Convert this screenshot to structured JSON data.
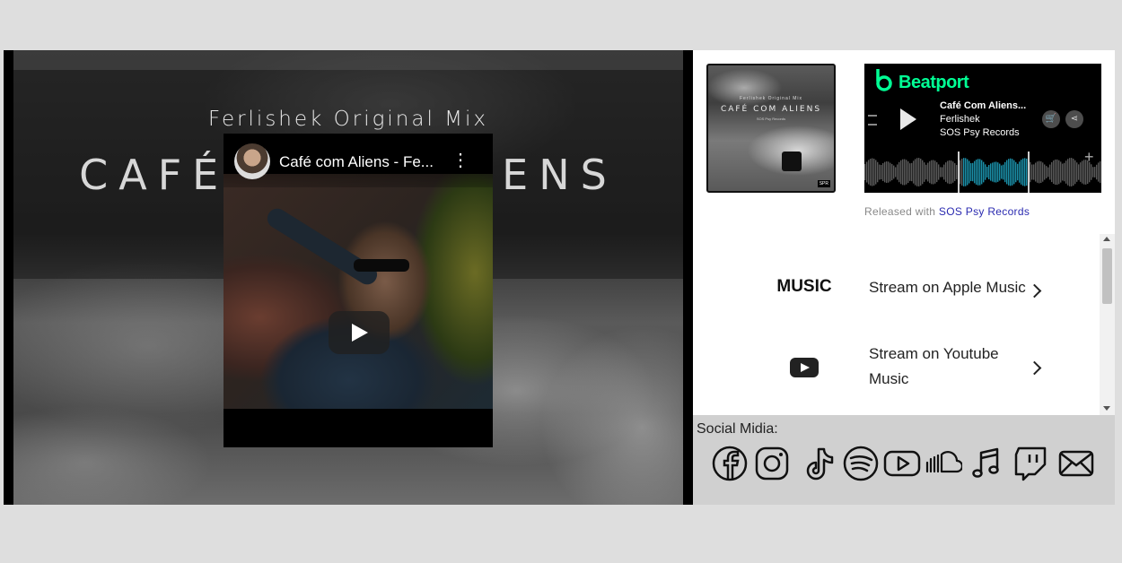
{
  "hero": {
    "subtitle": "Ferlishek Original Mix",
    "title": "CAFÉ COM ALIENS"
  },
  "youtube": {
    "title": "Café com Aliens - Fe...",
    "menu": "⋮"
  },
  "cover": {
    "subtitle": "Ferlishek Original Mix",
    "title": "CAFÉ COM ALIENS",
    "label": "SOS Psy Records",
    "badge": "SPR"
  },
  "beatport": {
    "brand": "Beatport",
    "track": "Café Com Aliens...",
    "artist": "Ferlishek",
    "label": "SOS Psy Records",
    "plus": "+",
    "brand_color": "#01ff95"
  },
  "released": {
    "prefix": "Released with",
    "label": "SOS Psy Records"
  },
  "streaming": [
    {
      "logo_text": "MUSIC",
      "logo_icon": "apple-icon",
      "line1": "Stream on Apple Music",
      "line2": ""
    },
    {
      "logo_icon": "youtube-icon",
      "line1": "Stream on Youtube",
      "line2": "Music"
    }
  ],
  "social": {
    "title": "Social Midia:",
    "icons": [
      "facebook-icon",
      "instagram-icon",
      "tiktok-icon",
      "spotify-icon",
      "youtube-icon",
      "soundcloud-icon",
      "music-note-icon",
      "twitch-icon",
      "mail-icon"
    ]
  }
}
